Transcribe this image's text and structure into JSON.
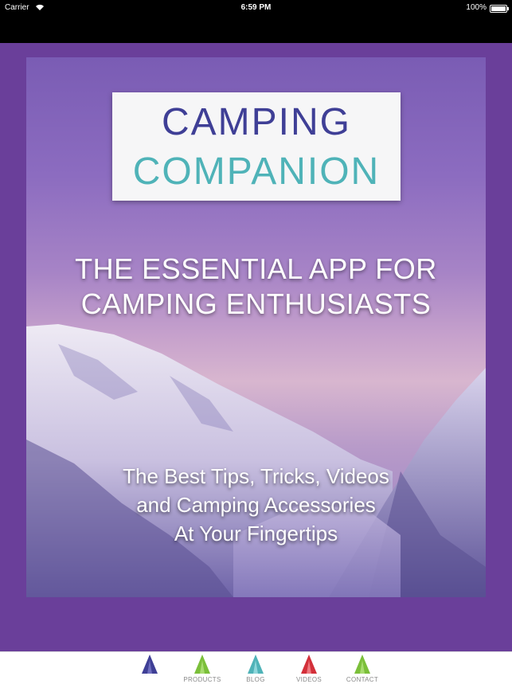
{
  "status_bar": {
    "carrier": "Carrier",
    "time": "6:59 PM",
    "battery": "100%"
  },
  "logo": {
    "line1": "CAMPING",
    "line2": "COMPANION",
    "line1_color": "#3f3f96",
    "line2_color": "#4fb3b8"
  },
  "poster": {
    "headline_1": "THE ESSENTIAL APP FOR",
    "headline_2": "CAMPING ENTHUSIASTS",
    "subline_1": "The Best Tips, Tricks, Videos",
    "subline_2": "and Camping Accessories",
    "subline_3": "At Your Fingertips",
    "frame_color": "#6a3f9a"
  },
  "tabs": [
    {
      "label": "",
      "icon": "tent-icon",
      "color": "#3f3f96"
    },
    {
      "label": "PRODUCTS",
      "icon": "tent-icon",
      "color": "#7bbf3a"
    },
    {
      "label": "BLOG",
      "icon": "tent-icon",
      "color": "#4fb3b8"
    },
    {
      "label": "VIDEOS",
      "icon": "tent-icon",
      "color": "#d3303a"
    },
    {
      "label": "CONTACT",
      "icon": "tent-icon",
      "color": "#7bbf3a"
    }
  ]
}
